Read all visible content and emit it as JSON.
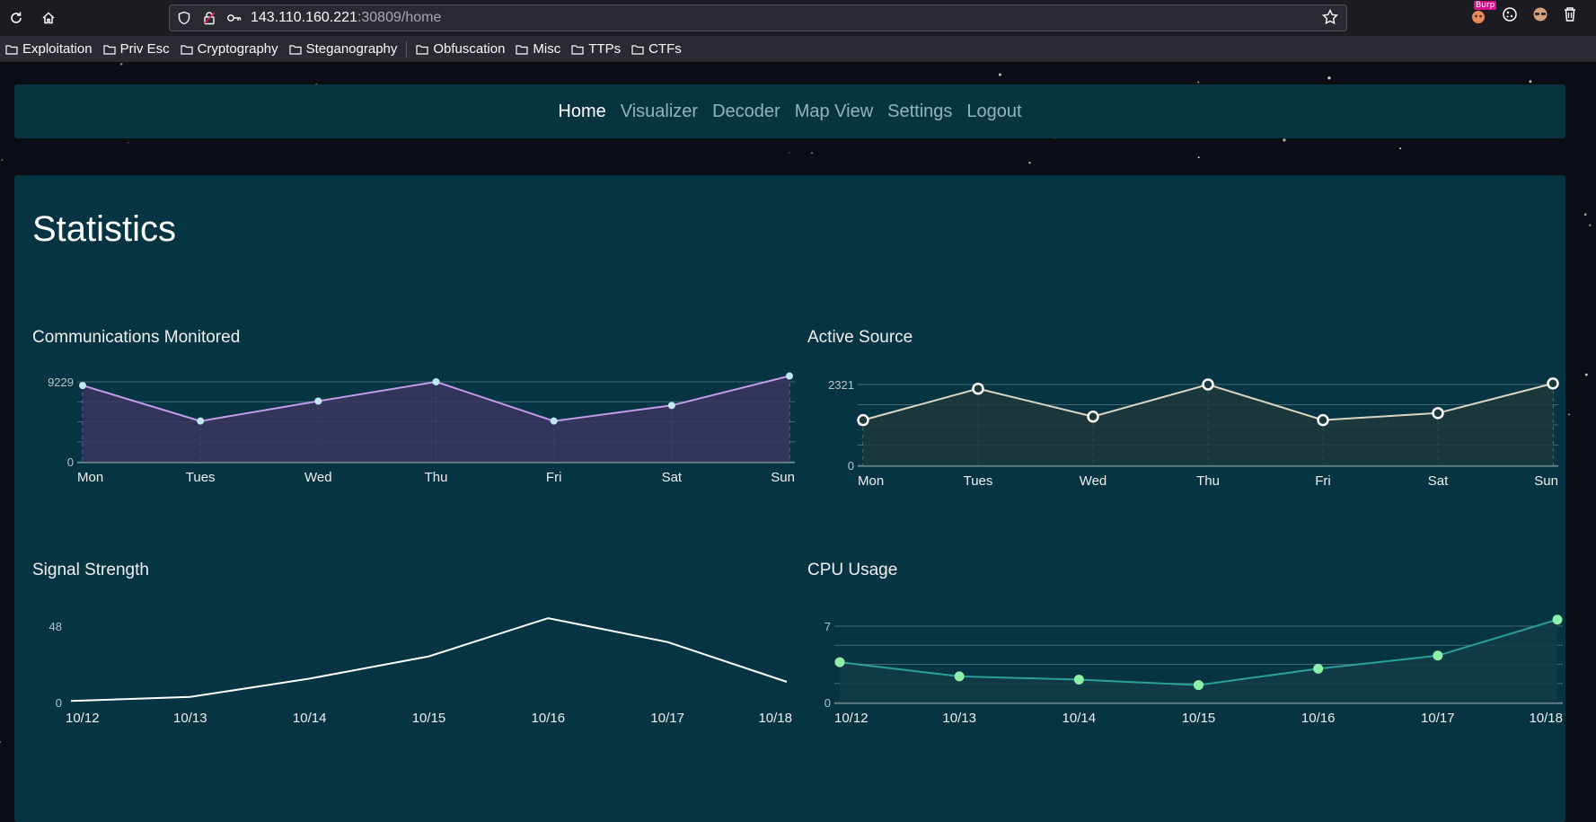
{
  "browser": {
    "url_host": "143.110.160.221",
    "url_rest": ":30809/home",
    "ext_badge": "Burp",
    "bookmarks": [
      "Exploitation",
      "Priv Esc",
      "Cryptography",
      "Steganography",
      "Obfuscation",
      "Misc",
      "TTPs",
      "CTFs"
    ]
  },
  "nav": {
    "items": [
      "Home",
      "Visualizer",
      "Decoder",
      "Map View",
      "Settings",
      "Logout"
    ],
    "active": "Home"
  },
  "page": {
    "title": "Statistics"
  },
  "chart_data": [
    {
      "type": "area",
      "title": "Communications Monitored",
      "categories": [
        "Mon",
        "Tues",
        "Wed",
        "Thu",
        "Fri",
        "Sat",
        "Sun"
      ],
      "values": [
        8800,
        4700,
        7000,
        9229,
        4700,
        6500,
        9900
      ],
      "ylim": [
        0,
        9229
      ],
      "ytick_labels": [
        "9229",
        "0"
      ],
      "grid": true,
      "line_color": "#c39bea",
      "point_color": "#bfe8f2",
      "fill_color": "#3a3560"
    },
    {
      "type": "area",
      "title": "Active Source",
      "categories": [
        "Mon",
        "Tues",
        "Wed",
        "Thu",
        "Fri",
        "Sat",
        "Sun"
      ],
      "values": [
        1300,
        2200,
        1400,
        2321,
        1300,
        1500,
        2350
      ],
      "ylim": [
        0,
        2321
      ],
      "ytick_labels": [
        "2321",
        "0"
      ],
      "grid": true,
      "line_color": "#ded6c0",
      "point_color": "#ffffff",
      "fill_color": "#1d3a3a"
    },
    {
      "type": "line",
      "title": "Signal Strength",
      "categories": [
        "10/12",
        "10/13",
        "10/14",
        "10/15",
        "10/16",
        "10/17",
        "10/18"
      ],
      "values": [
        1,
        3.5,
        15,
        29,
        53,
        38,
        13
      ],
      "ylim": [
        0,
        48
      ],
      "ytick_labels": [
        "48",
        "0"
      ],
      "grid": false,
      "line_color": "#ffffff"
    },
    {
      "type": "area",
      "title": "CPU Usage",
      "categories": [
        "10/12",
        "10/13",
        "10/14",
        "10/15",
        "10/16",
        "10/17",
        "10/18"
      ],
      "values": [
        3.7,
        2.4,
        2.1,
        1.6,
        3.1,
        4.3,
        7.6
      ],
      "ylim": [
        0,
        7
      ],
      "ytick_labels": [
        "7",
        "0"
      ],
      "grid": true,
      "line_color": "#2aa198",
      "point_color": "#8ef0a8",
      "fill_color": "#123c46"
    }
  ]
}
